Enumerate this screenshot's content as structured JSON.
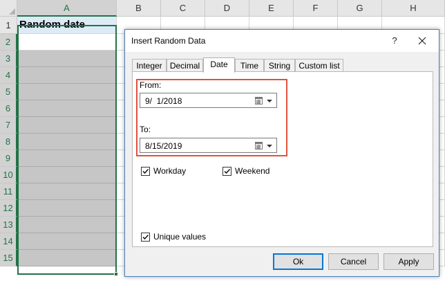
{
  "sheet": {
    "columns": [
      "A",
      "B",
      "C",
      "D",
      "E",
      "F",
      "G",
      "H"
    ],
    "rows": [
      "1",
      "2",
      "3",
      "4",
      "5",
      "6",
      "7",
      "8",
      "9",
      "10",
      "11",
      "12",
      "13",
      "14",
      "15"
    ],
    "cell_a1": "Random date",
    "accent_color": "#217346",
    "title_cell_color": "#ddebf7",
    "filled_cell_color": "#c6c6c6"
  },
  "dialog": {
    "title": "Insert Random Data",
    "help_glyph": "?",
    "close_icon": "close-icon",
    "tabs": [
      {
        "label": "Integer",
        "active": false
      },
      {
        "label": "Decimal",
        "active": false
      },
      {
        "label": "Date",
        "active": true
      },
      {
        "label": "Time",
        "active": false
      },
      {
        "label": "String",
        "active": false
      },
      {
        "label": "Custom list",
        "active": false
      }
    ],
    "from_label": "From:",
    "from_value": "9/  1/2018",
    "to_label": "To:",
    "to_value": "8/15/2019",
    "highlight_color": "#e0513d",
    "workday_label": "Workday",
    "workday_checked": true,
    "weekend_label": "Weekend",
    "weekend_checked": true,
    "unique_label": "Unique values",
    "unique_checked": true,
    "ok_label": "Ok",
    "cancel_label": "Cancel",
    "apply_label": "Apply"
  }
}
